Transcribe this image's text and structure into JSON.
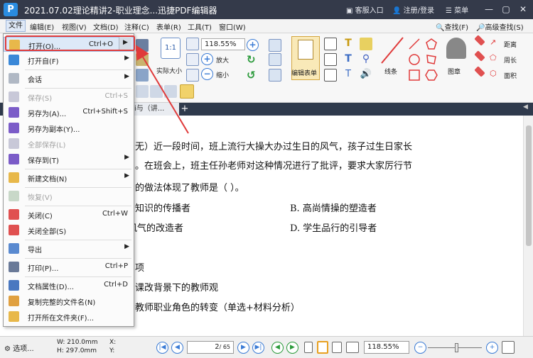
{
  "app": {
    "title": "2021.07.02理论精讲2-职业理念...迅捷PDF编辑器",
    "logo_letter": "P",
    "service": "客服入口",
    "login": "注册/登录",
    "menu": "菜单"
  },
  "menubar": {
    "items": [
      "文件",
      "编辑(E)",
      "视图(V)",
      "文档(D)",
      "注释(C)",
      "表单(R)",
      "工具(T)",
      "窗口(W)"
    ],
    "find": "查找(F)",
    "adv_find": "高级查找(S)"
  },
  "ribbon": {
    "zoom_value": "118.55%",
    "actual_size": "实际大小",
    "zoom_in": "放大",
    "zoom_out": "缩小",
    "edit_form": "编辑表单",
    "line": "线条",
    "stamp": "图章",
    "distance": "距离",
    "perimeter": "周长",
    "area": "面积"
  },
  "tabs": {
    "doc_tab": "i与（讲...",
    "plus": "+",
    "right_arrow": "◀"
  },
  "document": {
    "lines": [
      "无）近一段时间，班上流行大操大办过生日的风气，孩子过生日家长",
      "。在班会上，班主任孙老师对这种情况进行了批评，要求大家厉行节",
      "的做法体现了教师是（   ）。",
      "知识的传播者",
      "B. 高尚情操的塑造者",
      "风气的改造者",
      "D. 学生品行的引导者",
      "项",
      "课改背景下的教师观",
      "教师职业角色的转变（单选+材料分析）"
    ]
  },
  "file_menu": {
    "items": [
      {
        "label": "打开(O)...",
        "shortcut": "Ctrl+O",
        "arrow": "▶"
      },
      {
        "label": "打开自(F)",
        "arrow": "▶"
      },
      {
        "label": "会话",
        "arrow": "▶"
      },
      {
        "label": "保存(S)",
        "shortcut": "Ctrl+S"
      },
      {
        "label": "另存为(A)...",
        "shortcut": "Ctrl+Shift+S"
      },
      {
        "label": "另存为副本(Y)..."
      },
      {
        "label": "全部保存(L)"
      },
      {
        "label": "保存到(T)",
        "arrow": "▶"
      },
      {
        "label": "新建文档(N)",
        "arrow": "▶"
      },
      {
        "label": "恢复(V)"
      },
      {
        "label": "关闭(C)",
        "shortcut": "Ctrl+W"
      },
      {
        "label": "关闭全部(S)"
      },
      {
        "label": "导出",
        "arrow": "▶"
      },
      {
        "label": "打印(P)...",
        "shortcut": "Ctrl+P"
      },
      {
        "label": "文档属性(D)...",
        "shortcut": "Ctrl+D"
      },
      {
        "label": "复制完整的文件名(N)"
      },
      {
        "label": "打开所在文件夹(F)..."
      }
    ]
  },
  "statusbar": {
    "options": "选项...",
    "width": "W: 210.0mm",
    "height": "H: 297.0mm",
    "x": "X:",
    "y": "Y:",
    "page": "2",
    "total": "/ 65",
    "zoom": "118.55%"
  },
  "colors": {
    "titlebar": "#343a4a",
    "accent": "#3a7bd5",
    "highlight_box": "#e03a3a"
  }
}
